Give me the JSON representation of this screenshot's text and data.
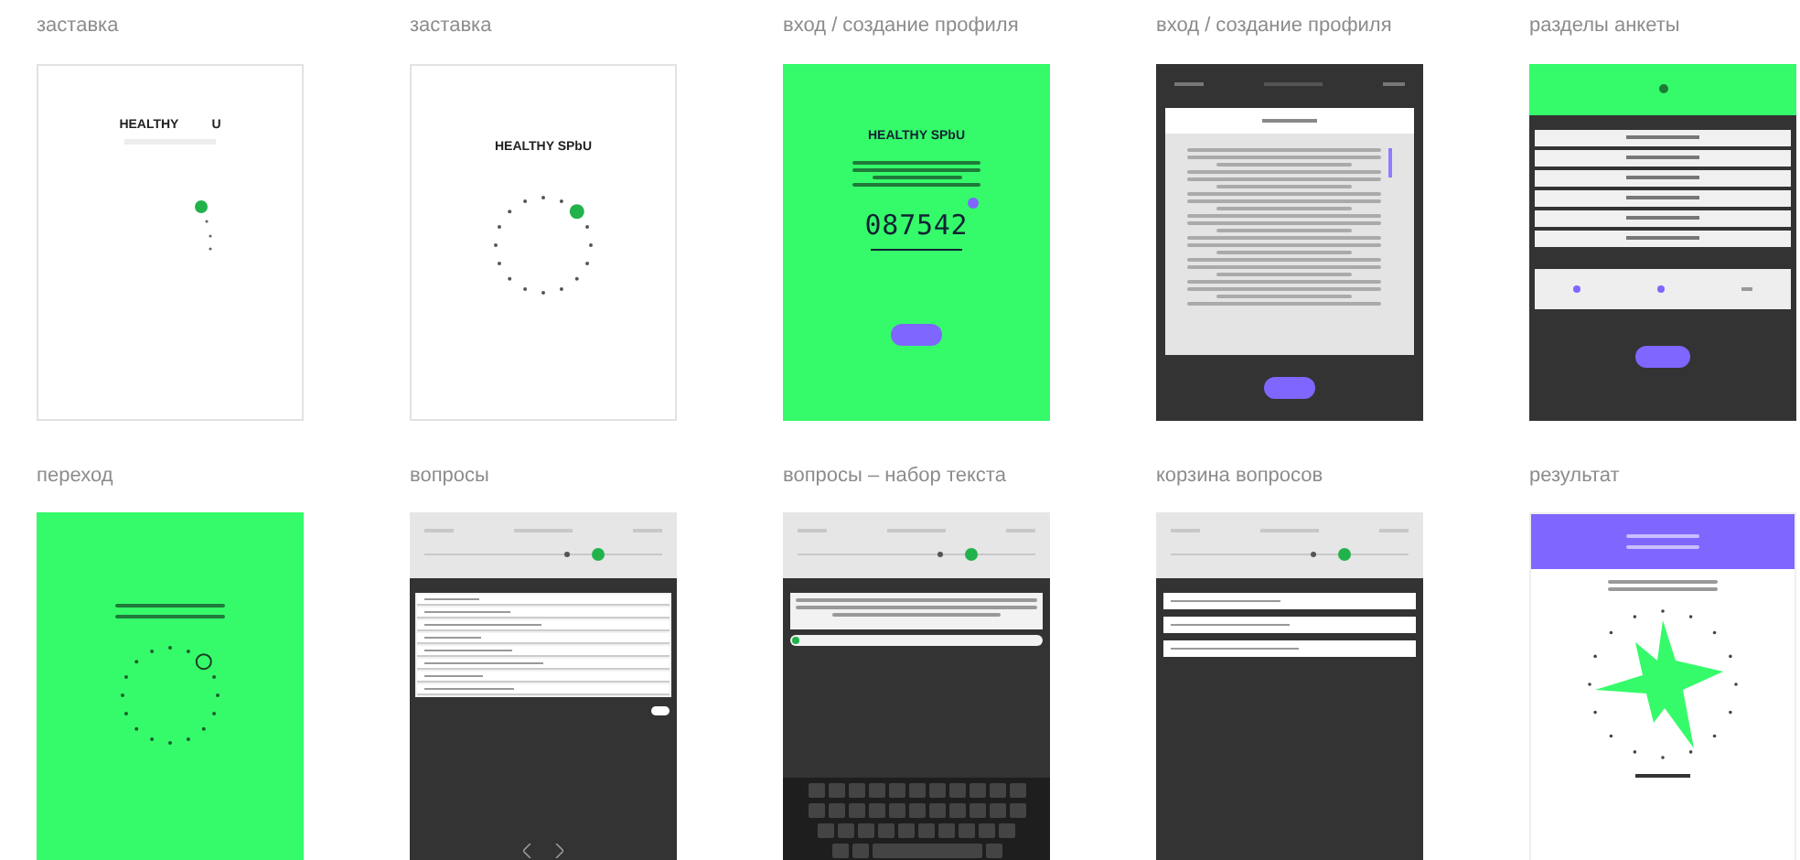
{
  "screens": [
    {
      "caption": "заставка",
      "kind": "splash_partial",
      "title_parts": [
        "HEALTHY",
        "U"
      ]
    },
    {
      "caption": "заставка",
      "kind": "splash",
      "title": "HEALTHY SPbU"
    },
    {
      "caption": "вход / создание профиля",
      "kind": "login",
      "title": "HEALTHY SPbU",
      "code": "087542"
    },
    {
      "caption": "вход / создание профиля",
      "kind": "terms"
    },
    {
      "caption": "разделы анкеты",
      "kind": "sections"
    },
    {
      "caption": "переход",
      "kind": "transition"
    },
    {
      "caption": "вопросы",
      "kind": "questions"
    },
    {
      "caption": "вопросы – набор текста",
      "kind": "typing"
    },
    {
      "caption": "корзина вопросов",
      "kind": "cart"
    },
    {
      "caption": "результат",
      "kind": "result"
    }
  ]
}
